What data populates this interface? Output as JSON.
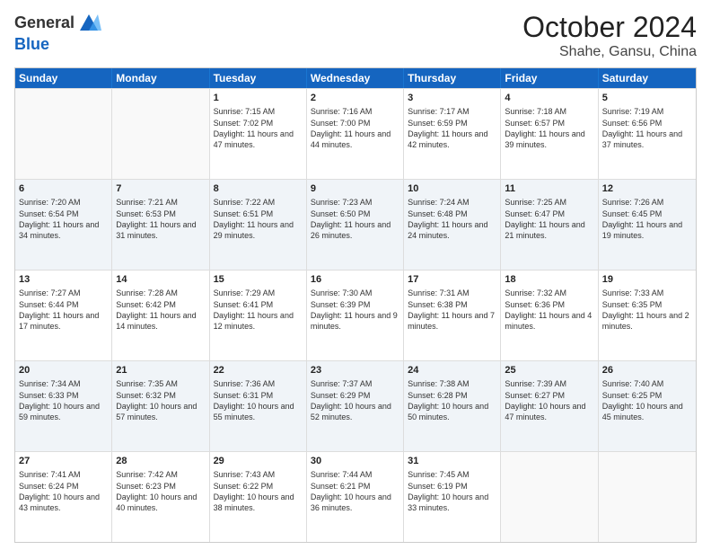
{
  "header": {
    "logo_general": "General",
    "logo_blue": "Blue",
    "month": "October 2024",
    "location": "Shahe, Gansu, China"
  },
  "days_of_week": [
    "Sunday",
    "Monday",
    "Tuesday",
    "Wednesday",
    "Thursday",
    "Friday",
    "Saturday"
  ],
  "weeks": [
    [
      {
        "day": "",
        "sunrise": "",
        "sunset": "",
        "daylight": ""
      },
      {
        "day": "",
        "sunrise": "",
        "sunset": "",
        "daylight": ""
      },
      {
        "day": "1",
        "sunrise": "Sunrise: 7:15 AM",
        "sunset": "Sunset: 7:02 PM",
        "daylight": "Daylight: 11 hours and 47 minutes."
      },
      {
        "day": "2",
        "sunrise": "Sunrise: 7:16 AM",
        "sunset": "Sunset: 7:00 PM",
        "daylight": "Daylight: 11 hours and 44 minutes."
      },
      {
        "day": "3",
        "sunrise": "Sunrise: 7:17 AM",
        "sunset": "Sunset: 6:59 PM",
        "daylight": "Daylight: 11 hours and 42 minutes."
      },
      {
        "day": "4",
        "sunrise": "Sunrise: 7:18 AM",
        "sunset": "Sunset: 6:57 PM",
        "daylight": "Daylight: 11 hours and 39 minutes."
      },
      {
        "day": "5",
        "sunrise": "Sunrise: 7:19 AM",
        "sunset": "Sunset: 6:56 PM",
        "daylight": "Daylight: 11 hours and 37 minutes."
      }
    ],
    [
      {
        "day": "6",
        "sunrise": "Sunrise: 7:20 AM",
        "sunset": "Sunset: 6:54 PM",
        "daylight": "Daylight: 11 hours and 34 minutes."
      },
      {
        "day": "7",
        "sunrise": "Sunrise: 7:21 AM",
        "sunset": "Sunset: 6:53 PM",
        "daylight": "Daylight: 11 hours and 31 minutes."
      },
      {
        "day": "8",
        "sunrise": "Sunrise: 7:22 AM",
        "sunset": "Sunset: 6:51 PM",
        "daylight": "Daylight: 11 hours and 29 minutes."
      },
      {
        "day": "9",
        "sunrise": "Sunrise: 7:23 AM",
        "sunset": "Sunset: 6:50 PM",
        "daylight": "Daylight: 11 hours and 26 minutes."
      },
      {
        "day": "10",
        "sunrise": "Sunrise: 7:24 AM",
        "sunset": "Sunset: 6:48 PM",
        "daylight": "Daylight: 11 hours and 24 minutes."
      },
      {
        "day": "11",
        "sunrise": "Sunrise: 7:25 AM",
        "sunset": "Sunset: 6:47 PM",
        "daylight": "Daylight: 11 hours and 21 minutes."
      },
      {
        "day": "12",
        "sunrise": "Sunrise: 7:26 AM",
        "sunset": "Sunset: 6:45 PM",
        "daylight": "Daylight: 11 hours and 19 minutes."
      }
    ],
    [
      {
        "day": "13",
        "sunrise": "Sunrise: 7:27 AM",
        "sunset": "Sunset: 6:44 PM",
        "daylight": "Daylight: 11 hours and 17 minutes."
      },
      {
        "day": "14",
        "sunrise": "Sunrise: 7:28 AM",
        "sunset": "Sunset: 6:42 PM",
        "daylight": "Daylight: 11 hours and 14 minutes."
      },
      {
        "day": "15",
        "sunrise": "Sunrise: 7:29 AM",
        "sunset": "Sunset: 6:41 PM",
        "daylight": "Daylight: 11 hours and 12 minutes."
      },
      {
        "day": "16",
        "sunrise": "Sunrise: 7:30 AM",
        "sunset": "Sunset: 6:39 PM",
        "daylight": "Daylight: 11 hours and 9 minutes."
      },
      {
        "day": "17",
        "sunrise": "Sunrise: 7:31 AM",
        "sunset": "Sunset: 6:38 PM",
        "daylight": "Daylight: 11 hours and 7 minutes."
      },
      {
        "day": "18",
        "sunrise": "Sunrise: 7:32 AM",
        "sunset": "Sunset: 6:36 PM",
        "daylight": "Daylight: 11 hours and 4 minutes."
      },
      {
        "day": "19",
        "sunrise": "Sunrise: 7:33 AM",
        "sunset": "Sunset: 6:35 PM",
        "daylight": "Daylight: 11 hours and 2 minutes."
      }
    ],
    [
      {
        "day": "20",
        "sunrise": "Sunrise: 7:34 AM",
        "sunset": "Sunset: 6:33 PM",
        "daylight": "Daylight: 10 hours and 59 minutes."
      },
      {
        "day": "21",
        "sunrise": "Sunrise: 7:35 AM",
        "sunset": "Sunset: 6:32 PM",
        "daylight": "Daylight: 10 hours and 57 minutes."
      },
      {
        "day": "22",
        "sunrise": "Sunrise: 7:36 AM",
        "sunset": "Sunset: 6:31 PM",
        "daylight": "Daylight: 10 hours and 55 minutes."
      },
      {
        "day": "23",
        "sunrise": "Sunrise: 7:37 AM",
        "sunset": "Sunset: 6:29 PM",
        "daylight": "Daylight: 10 hours and 52 minutes."
      },
      {
        "day": "24",
        "sunrise": "Sunrise: 7:38 AM",
        "sunset": "Sunset: 6:28 PM",
        "daylight": "Daylight: 10 hours and 50 minutes."
      },
      {
        "day": "25",
        "sunrise": "Sunrise: 7:39 AM",
        "sunset": "Sunset: 6:27 PM",
        "daylight": "Daylight: 10 hours and 47 minutes."
      },
      {
        "day": "26",
        "sunrise": "Sunrise: 7:40 AM",
        "sunset": "Sunset: 6:25 PM",
        "daylight": "Daylight: 10 hours and 45 minutes."
      }
    ],
    [
      {
        "day": "27",
        "sunrise": "Sunrise: 7:41 AM",
        "sunset": "Sunset: 6:24 PM",
        "daylight": "Daylight: 10 hours and 43 minutes."
      },
      {
        "day": "28",
        "sunrise": "Sunrise: 7:42 AM",
        "sunset": "Sunset: 6:23 PM",
        "daylight": "Daylight: 10 hours and 40 minutes."
      },
      {
        "day": "29",
        "sunrise": "Sunrise: 7:43 AM",
        "sunset": "Sunset: 6:22 PM",
        "daylight": "Daylight: 10 hours and 38 minutes."
      },
      {
        "day": "30",
        "sunrise": "Sunrise: 7:44 AM",
        "sunset": "Sunset: 6:21 PM",
        "daylight": "Daylight: 10 hours and 36 minutes."
      },
      {
        "day": "31",
        "sunrise": "Sunrise: 7:45 AM",
        "sunset": "Sunset: 6:19 PM",
        "daylight": "Daylight: 10 hours and 33 minutes."
      },
      {
        "day": "",
        "sunrise": "",
        "sunset": "",
        "daylight": ""
      },
      {
        "day": "",
        "sunrise": "",
        "sunset": "",
        "daylight": ""
      }
    ]
  ]
}
